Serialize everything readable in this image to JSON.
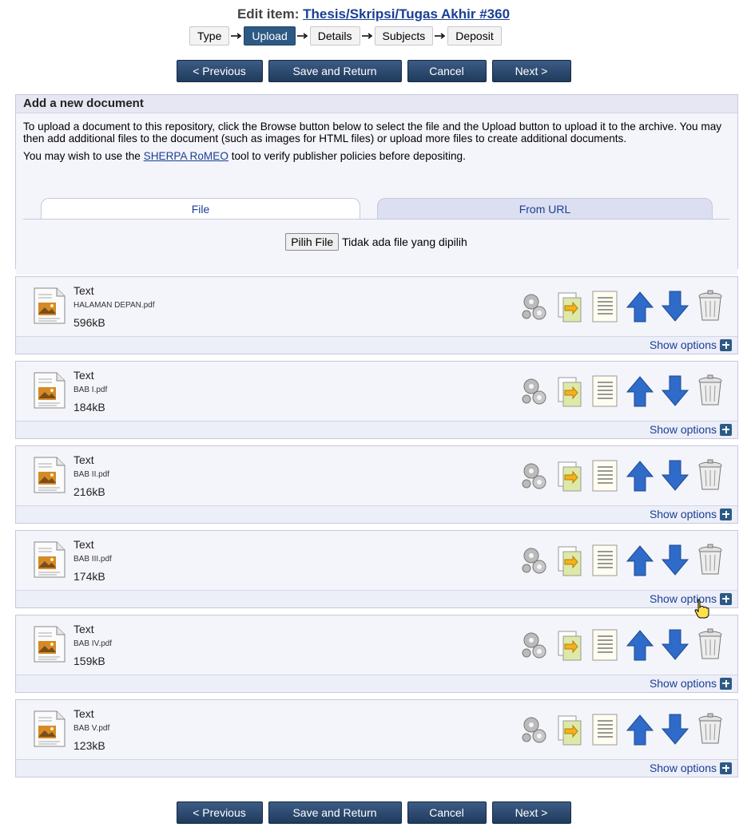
{
  "header": {
    "title_prefix": "Edit item:",
    "title_link": "Thesis/Skripsi/Tugas Akhir #360"
  },
  "steps": [
    {
      "label": "Type",
      "active": false
    },
    {
      "label": "Upload",
      "active": true
    },
    {
      "label": "Details",
      "active": false
    },
    {
      "label": "Subjects",
      "active": false
    },
    {
      "label": "Deposit",
      "active": false
    }
  ],
  "actions": {
    "previous": "< Previous",
    "save_return": "Save and Return",
    "cancel": "Cancel",
    "next": "Next >"
  },
  "upload_panel": {
    "heading": "Add a new document",
    "intro": "To upload a document to this repository, click the Browse button below to select the file and the Upload button to upload it to the archive. You may then add additional files to the document (such as images for HTML files) or upload more files to create additional documents.",
    "sherpa_prefix": "You may wish to use the",
    "sherpa_link": "SHERPA RoMEO",
    "sherpa_suffix": "tool to verify publisher policies before depositing.",
    "tabs": {
      "file": "File",
      "url": "From URL"
    },
    "choose_file_label": "Pilih File",
    "no_file_text": "Tidak ada file yang dipilih"
  },
  "documents": [
    {
      "type": "Text",
      "filename": "HALAMAN DEPAN.pdf",
      "size": "596kB",
      "options_label": "Show options"
    },
    {
      "type": "Text",
      "filename": "BAB I.pdf",
      "size": "184kB",
      "options_label": "Show options"
    },
    {
      "type": "Text",
      "filename": "BAB II.pdf",
      "size": "216kB",
      "options_label": "Show options"
    },
    {
      "type": "Text",
      "filename": "BAB III.pdf",
      "size": "174kB",
      "options_label": "Show options"
    },
    {
      "type": "Text",
      "filename": "BAB IV.pdf",
      "size": "159kB",
      "options_label": "Show options"
    },
    {
      "type": "Text",
      "filename": "BAB V.pdf",
      "size": "123kB",
      "options_label": "Show options"
    }
  ],
  "doc_tool_icons": [
    "gears-icon",
    "convert-document-icon",
    "details-list-icon",
    "move-up-icon",
    "move-down-icon",
    "trash-icon"
  ],
  "colors": {
    "accent": "#2d5a84",
    "link": "#1a3f94",
    "panel_bg": "#f4f4fb"
  }
}
